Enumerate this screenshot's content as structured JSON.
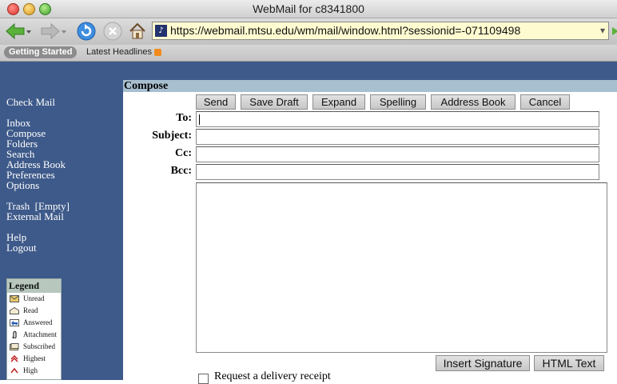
{
  "window": {
    "title": "WebMail for c8341800"
  },
  "browser": {
    "url": "https://webmail.mtsu.edu/wm/mail/window.html?sessionid=-071109498",
    "bookmarks": [
      {
        "label": "Getting Started"
      },
      {
        "label": "Latest Headlines"
      }
    ]
  },
  "sidebar": {
    "items": [
      {
        "label": "Check Mail"
      },
      {
        "label": "Inbox"
      },
      {
        "label": "Compose"
      },
      {
        "label": "Folders"
      },
      {
        "label": "Search"
      },
      {
        "label": "Address Book"
      },
      {
        "label": "Preferences"
      },
      {
        "label": "Options"
      },
      {
        "label": "Trash  [Empty]"
      },
      {
        "label": "External Mail"
      },
      {
        "label": "Help"
      },
      {
        "label": "Logout"
      }
    ]
  },
  "legend": {
    "title": "Legend",
    "items": [
      {
        "label": "Unread",
        "icon": "envelope-closed-icon"
      },
      {
        "label": "Read",
        "icon": "envelope-open-icon"
      },
      {
        "label": "Answered",
        "icon": "reply-icon"
      },
      {
        "label": "Attachment",
        "icon": "paperclip-icon"
      },
      {
        "label": "Subscribed",
        "icon": "subscribed-icon"
      },
      {
        "label": "Highest",
        "icon": "priority-highest-icon"
      },
      {
        "label": "High",
        "icon": "priority-high-icon"
      }
    ]
  },
  "compose": {
    "heading": "Compose",
    "buttons": {
      "send": "Send",
      "save_draft": "Save Draft",
      "expand": "Expand",
      "spelling": "Spelling",
      "address_book": "Address Book",
      "cancel": "Cancel"
    },
    "fields": {
      "to_label": "To:",
      "to_value": "",
      "subject_label": "Subject:",
      "subject_value": "",
      "cc_label": "Cc:",
      "cc_value": "",
      "bcc_label": "Bcc:",
      "bcc_value": ""
    },
    "body_value": "",
    "insert_signature": "Insert Signature",
    "html_text": "HTML Text",
    "delivery_receipt_label": "Request a delivery receipt"
  },
  "colors": {
    "sidebar": "#3e5a8a",
    "compose_header": "#a8bfd0",
    "legend_header": "#b7c7bd",
    "url_bar": "#fffbd0"
  }
}
